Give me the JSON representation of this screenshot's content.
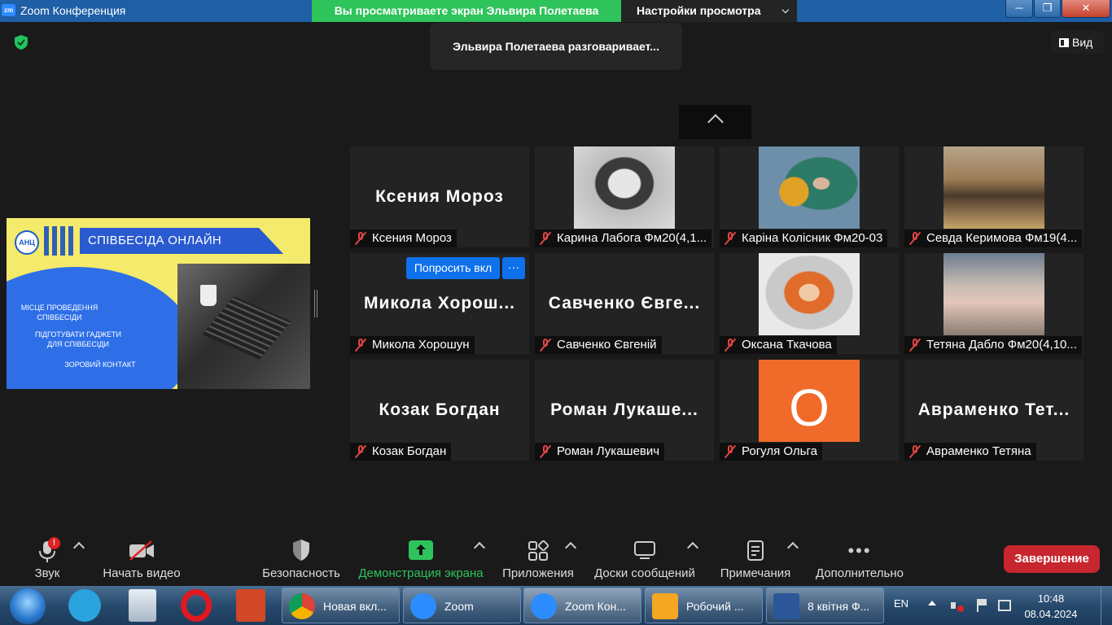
{
  "window": {
    "app_icon": "zm",
    "title": "Zoom Конференция"
  },
  "share_banner": "Вы просматриваете экран Эльвира Полетаева",
  "view_options": {
    "label": "Настройки просмотра"
  },
  "speaking_indicator": "Эльвира Полетаева разговаривает...",
  "view_button": "Вид",
  "shared_slide": {
    "logo": "АНЦ",
    "title": "СПІВБЕСІДА ОНЛАЙН",
    "line1": "МІСЦЕ ПРОВЕДЕННЯ СПІВБЕСІДИ",
    "line2": "ПІДГОТУВАТИ ГАДЖЕТИ ДЛЯ СПІВБЕСІДИ",
    "line3": "ЗОРОВИЙ КОНТАКТ"
  },
  "participants": [
    {
      "big": "Ксения Мороз",
      "name": "Ксения Мороз"
    },
    {
      "big": "",
      "name": "Карина Лабога Фм20(4,1..."
    },
    {
      "big": "",
      "name": "Каріна Колісник Фм20-03"
    },
    {
      "big": "",
      "name": "Севда Керимова Фм19(4..."
    },
    {
      "big": "Микола Хорош...",
      "name": "Микола Хорошун"
    },
    {
      "big": "Савченко Євге...",
      "name": "Савченко Євгеній"
    },
    {
      "big": "",
      "name": "Оксана Ткачова"
    },
    {
      "big": "",
      "name": "Тетяна Дабло Фм20(4,10..."
    },
    {
      "big": "Козак Богдан",
      "name": "Козак Богдан"
    },
    {
      "big": "Роман Лукаше...",
      "name": "Роман Лукашевич"
    },
    {
      "big": "O",
      "name": "Рогуля Ольга"
    },
    {
      "big": "Авраменко Тет...",
      "name": "Авраменко Тетяна"
    }
  ],
  "tile_actions": {
    "request": "Попросить вкл",
    "more": "···"
  },
  "toolbar": {
    "audio": "Звук",
    "video": "Начать видео",
    "security": "Безопасность",
    "share": "Демонстрация экрана",
    "apps": "Приложения",
    "whiteboards": "Доски сообщений",
    "notes": "Примечания",
    "more": "Дополнительно",
    "end": "Завершение",
    "alert_badge": "!"
  },
  "taskbar": {
    "tasks": [
      "Новая вкл...",
      "Zoom",
      "Zoom Кон...",
      "Робочий ...",
      "8 квітня Ф..."
    ],
    "lang": "EN",
    "time": "10:48",
    "date": "08.04.2024"
  },
  "colors": {
    "share_green": "#2fc35b",
    "end_red": "#c7262e",
    "accent_blue": "#0e71eb"
  }
}
